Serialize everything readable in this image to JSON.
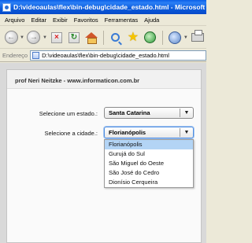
{
  "window": {
    "title": "D:\\videoaulas\\flex\\bin-debug\\cidade_estado.html - Microsoft Internet Explorer"
  },
  "menubar": {
    "items": [
      "Arquivo",
      "Editar",
      "Exibir",
      "Favoritos",
      "Ferramentas",
      "Ajuda"
    ]
  },
  "toolbar": {
    "icons": [
      "back-icon",
      "forward-icon",
      "stop-icon",
      "refresh-icon",
      "home-icon",
      "search-icon",
      "favorites-icon",
      "history-icon",
      "mail-icon",
      "print-icon"
    ]
  },
  "address": {
    "label": "Endereço",
    "url": "D:\\videoaulas\\flex\\bin-debug\\cidade_estado.html"
  },
  "app": {
    "header": "prof Neri Neitzke - www.informaticon.com.br",
    "state_label": "Selecione um estado.:",
    "state_value": "Santa Catarina",
    "city_label": "Selecione a cidade.:",
    "city_value": "Florianópolis",
    "city_options": [
      "Florianópolis",
      "Gurujá do Sul",
      "São Miguel do Oeste",
      "São José do Cedro",
      "Dionísio Cerqueira"
    ],
    "selected_index": 0
  },
  "colors": {
    "titlebar": "#0b5bdb",
    "selection": "#b3d4f5",
    "focus": "#4f8de0"
  }
}
